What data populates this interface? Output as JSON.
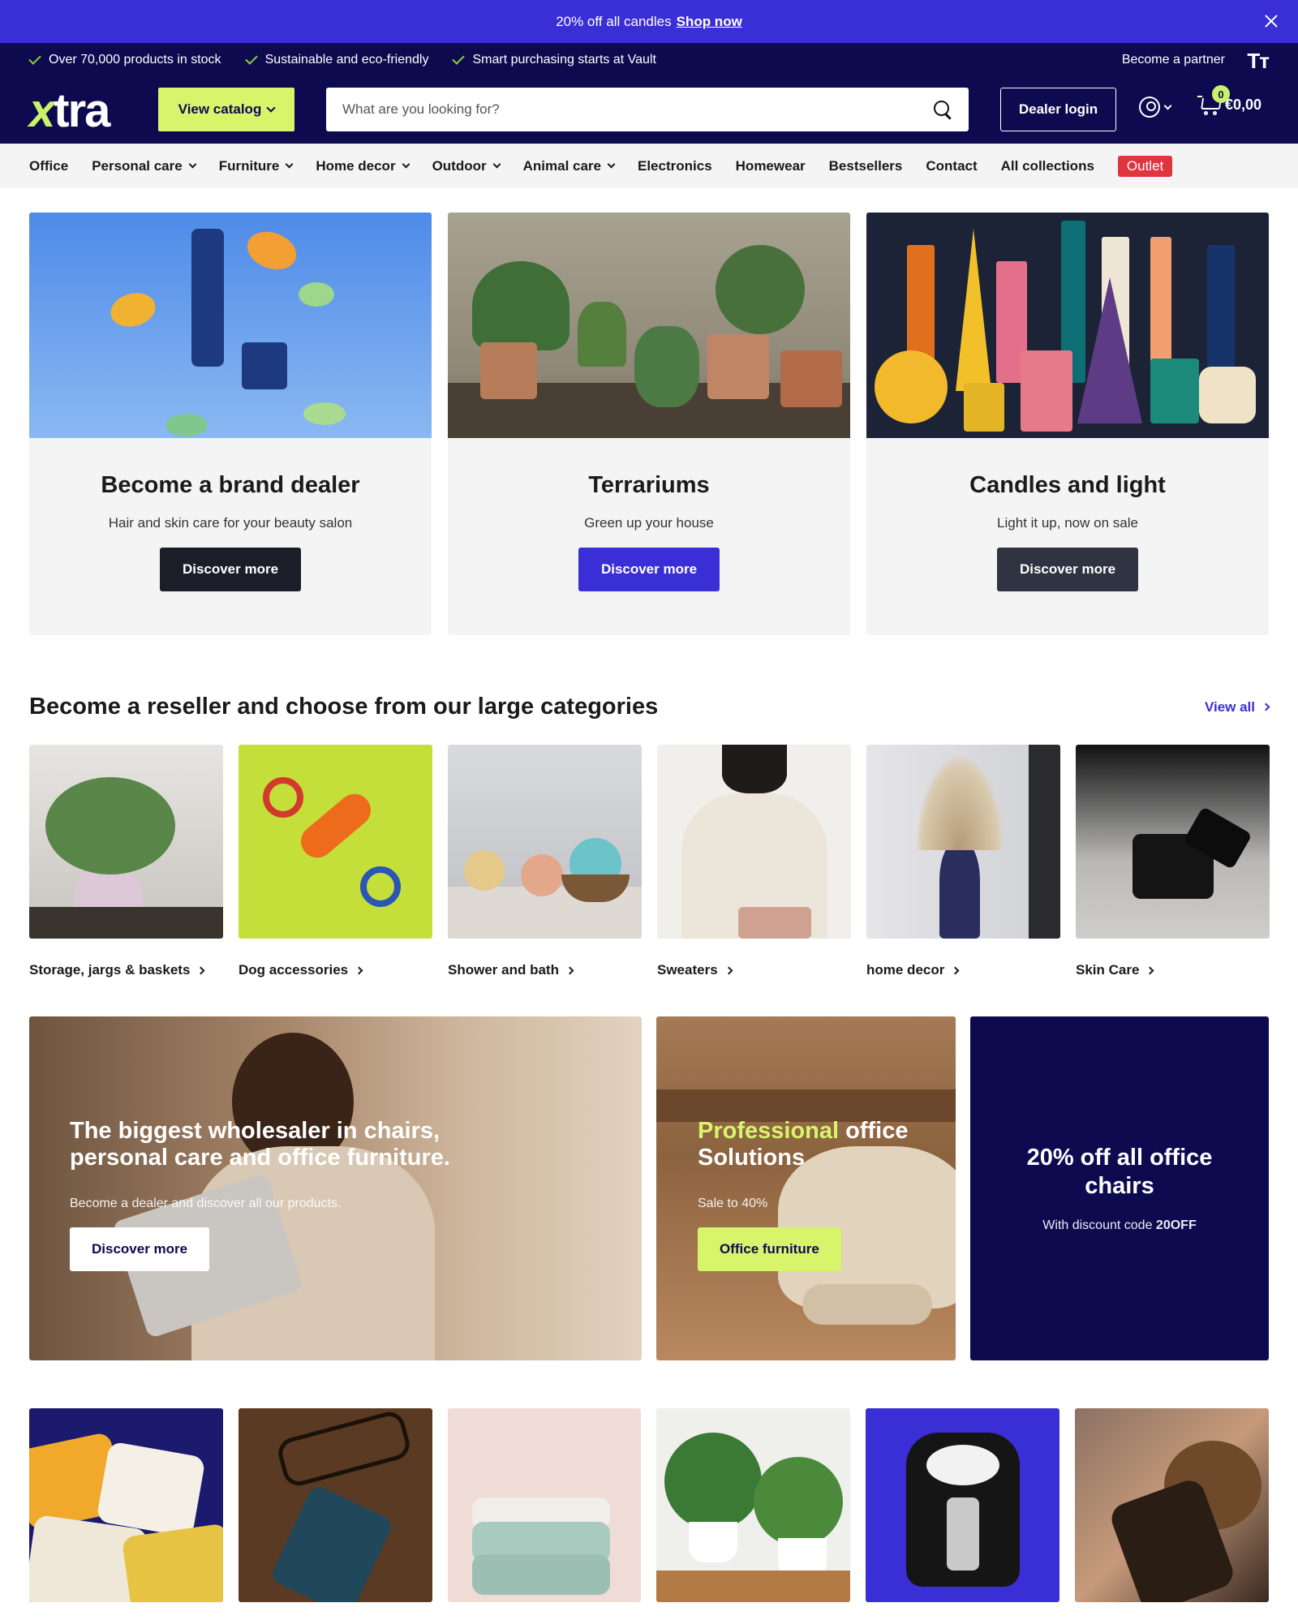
{
  "announcement": {
    "text": "20% off all candles",
    "link": "Shop now"
  },
  "usp": [
    "Over 70,000 products in stock",
    "Sustainable and eco-friendly",
    "Smart purchasing starts at Vault"
  ],
  "header": {
    "partner": "Become a partner",
    "text_size_icon": "Tт",
    "logo": {
      "x": "x",
      "rest": "tra"
    },
    "catalog_button": "View catalog",
    "search_placeholder": "What are you looking for?",
    "dealer_login": "Dealer login",
    "cart_count": "0",
    "cart_total": "€0,00"
  },
  "nav": {
    "items": [
      {
        "label": "Office",
        "dropdown": false
      },
      {
        "label": "Personal care",
        "dropdown": true
      },
      {
        "label": "Furniture",
        "dropdown": true
      },
      {
        "label": "Home decor",
        "dropdown": true
      },
      {
        "label": "Outdoor",
        "dropdown": true
      },
      {
        "label": "Animal care",
        "dropdown": true
      },
      {
        "label": "Electronics",
        "dropdown": false
      },
      {
        "label": "Homewear",
        "dropdown": false
      },
      {
        "label": "Bestsellers",
        "dropdown": false
      },
      {
        "label": "Contact",
        "dropdown": false
      },
      {
        "label": "All collections",
        "dropdown": false
      }
    ],
    "outlet": "Outlet"
  },
  "promos": [
    {
      "title": "Become a brand dealer",
      "subtitle": "Hair and skin care for your beauty salon",
      "button": "Discover more",
      "button_color": "#1b1e29"
    },
    {
      "title": "Terrariums",
      "subtitle": "Green up your house",
      "button": "Discover more",
      "button_color": "#3a2fd6"
    },
    {
      "title": "Candles and light",
      "subtitle": "Light it up, now on sale",
      "button": "Discover more",
      "button_color": "#2f3342"
    }
  ],
  "categories": {
    "heading": "Become a reseller and choose from our large categories",
    "view_all": "View all",
    "items": [
      "Storage, jargs & baskets",
      "Dog accessories",
      "Shower and bath",
      "Sweaters",
      "home decor",
      "Skin Care"
    ]
  },
  "banners": {
    "main": {
      "title_line1": "The biggest wholesaler in chairs,",
      "title_line2": "personal care and office furniture.",
      "subtitle": "Become a dealer and discover all our products.",
      "button": "Discover more"
    },
    "office": {
      "title_accent": "Professional",
      "title_rest": "office",
      "title_line2": "Solutions",
      "subtitle": "Sale to 40%",
      "button": "Office furniture"
    },
    "discount": {
      "title": "20% off all office chairs",
      "subtitle": "With discount code",
      "code": "20OFF"
    }
  },
  "colors": {
    "brand": "#3a2fd6",
    "header_bg": "#0d0a4f",
    "accent_lime": "#d6f56b",
    "outlet_red": "#e0343f"
  }
}
